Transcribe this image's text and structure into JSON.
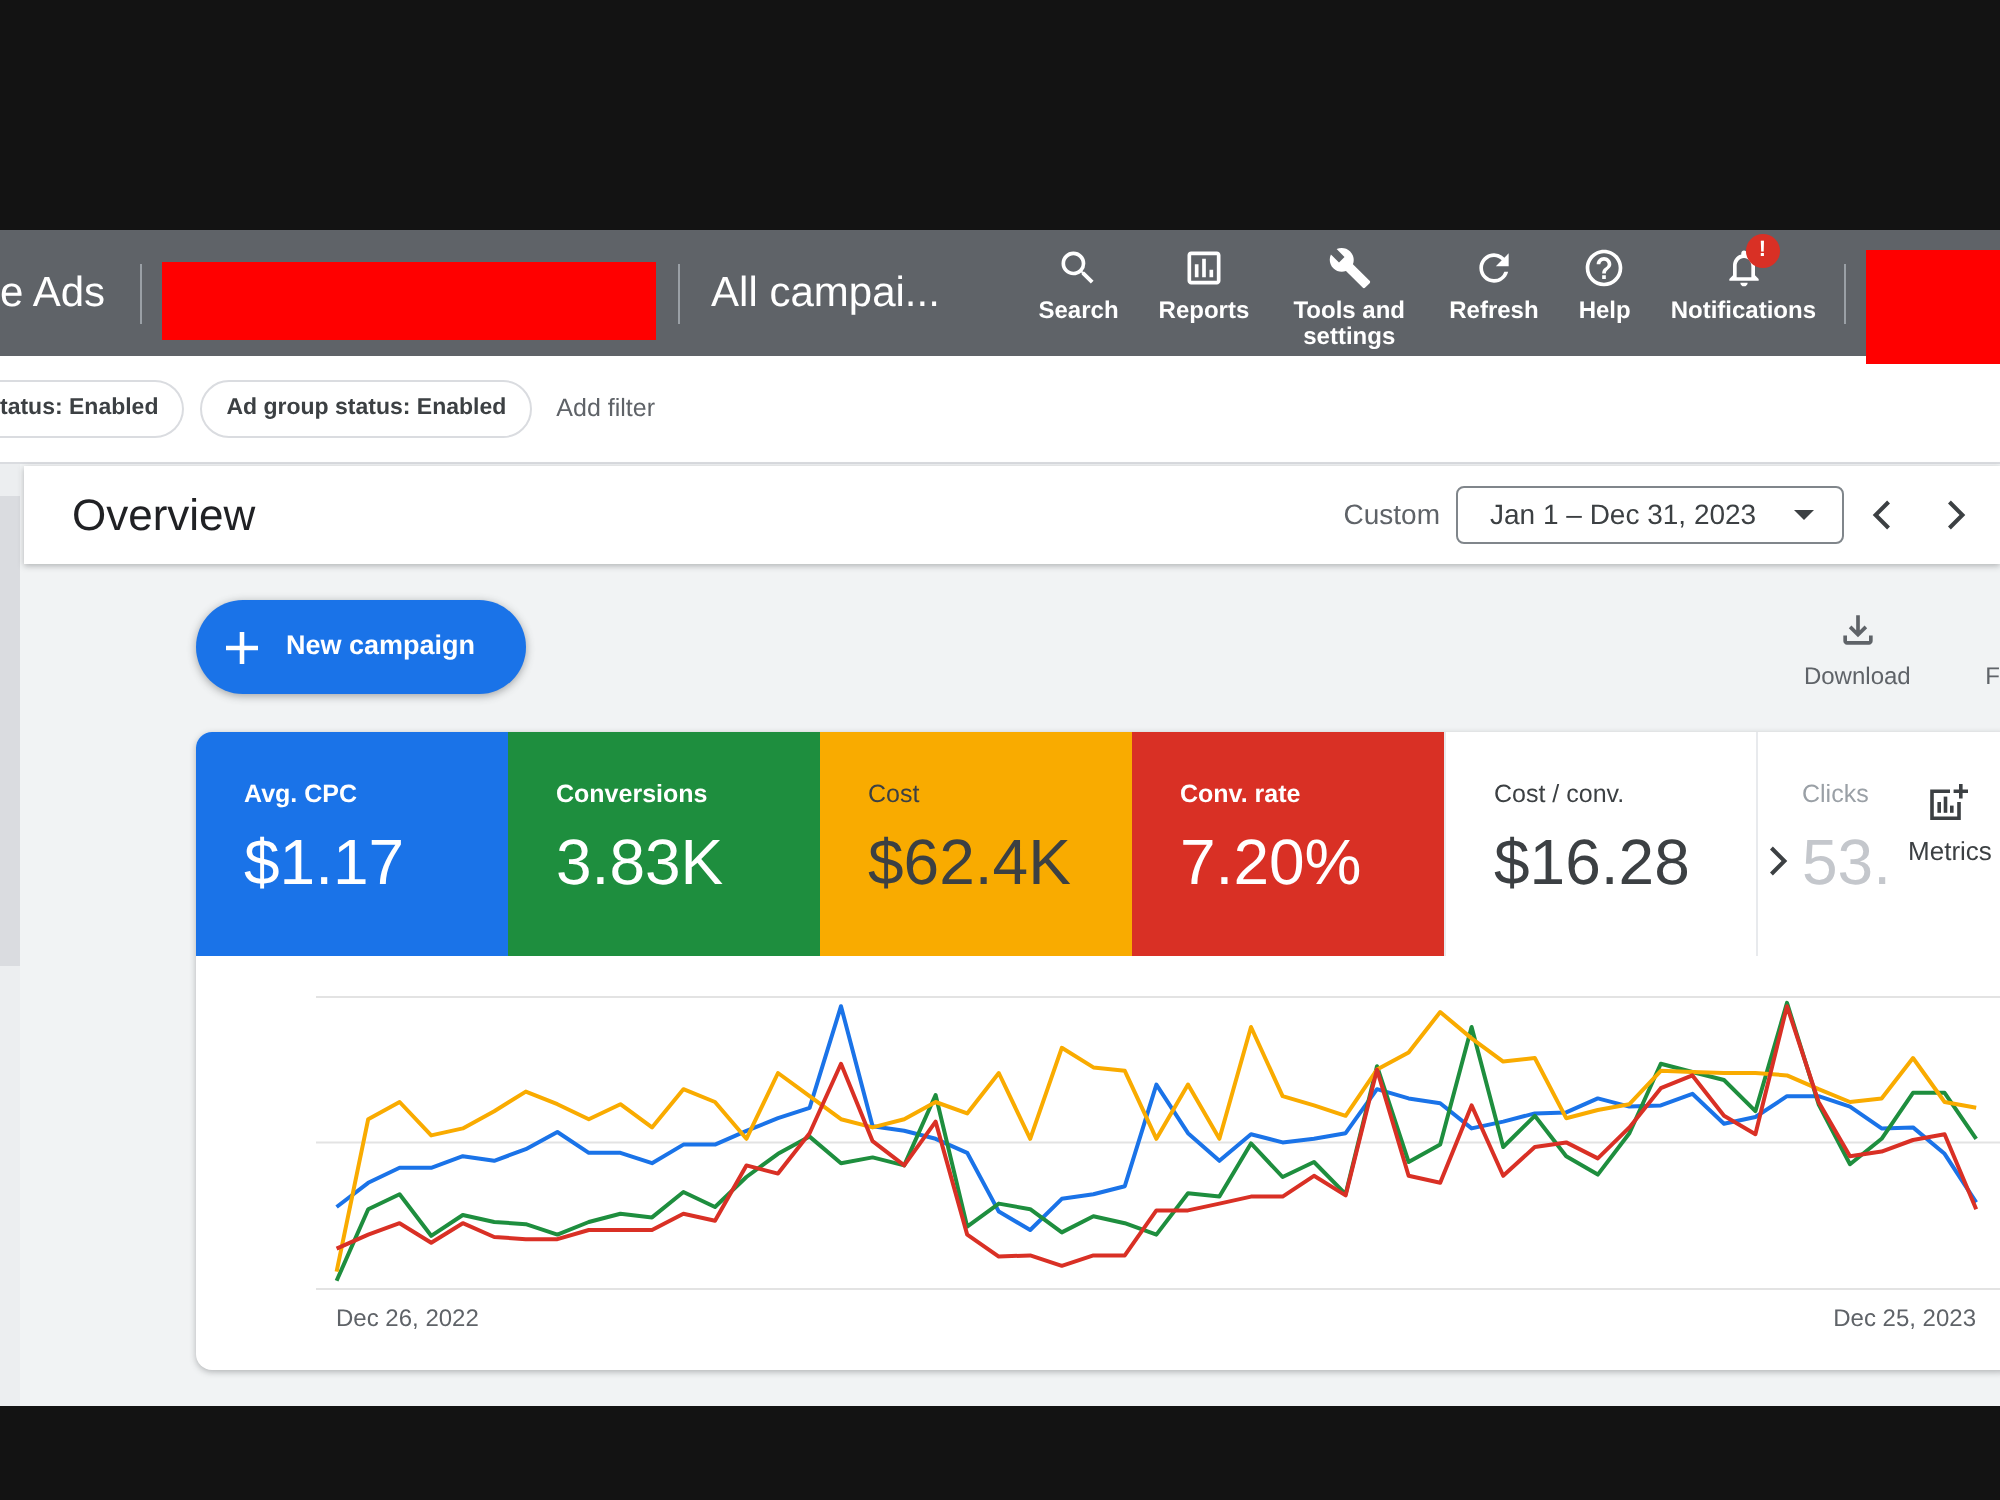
{
  "top_bar": {
    "product_name": "e Ads",
    "account_view": "All campai...",
    "nav": [
      {
        "kind": "search",
        "label": "Search"
      },
      {
        "kind": "reports",
        "label": "Reports"
      },
      {
        "kind": "tools",
        "label": "Tools and settings"
      },
      {
        "kind": "refresh",
        "label": "Refresh"
      },
      {
        "kind": "help",
        "label": "Help"
      },
      {
        "kind": "notifications",
        "label": "Notifications",
        "badge": "!"
      }
    ]
  },
  "filter_bar": {
    "chips": [
      "tatus: Enabled",
      "Ad group status: Enabled"
    ],
    "add_filter": "Add filter"
  },
  "overview": {
    "title": "Overview",
    "date_range_label": "Custom",
    "date_range": "Jan 1 – Dec 31, 2023"
  },
  "actions": {
    "new_campaign": "New campaign",
    "toolbar": [
      {
        "kind": "download",
        "label": "Download"
      },
      {
        "kind": "cut",
        "label": "F"
      }
    ]
  },
  "metrics": [
    {
      "label": "Avg. CPC",
      "value": "$1.17",
      "selected": true,
      "color": "#1a73e8",
      "faded": false
    },
    {
      "label": "Conversions",
      "value": "3.83K",
      "selected": true,
      "color": "#1e8e3e",
      "faded": false
    },
    {
      "label": "Cost",
      "value": "$62.4K",
      "selected": true,
      "color": "#f9ab00",
      "faded": false
    },
    {
      "label": "Conv. rate",
      "value": "7.20%",
      "selected": true,
      "color": "#d93025",
      "faded": false
    },
    {
      "label": "Cost / conv.",
      "value": "$16.28",
      "selected": false,
      "faded": false
    },
    {
      "label": "Clicks",
      "value": "53.",
      "selected": false,
      "faded": true
    }
  ],
  "metrics_button": "Metrics",
  "chart": {
    "x_start_label": "Dec 26, 2022",
    "x_end_label": "Dec 25, 2023"
  }
}
